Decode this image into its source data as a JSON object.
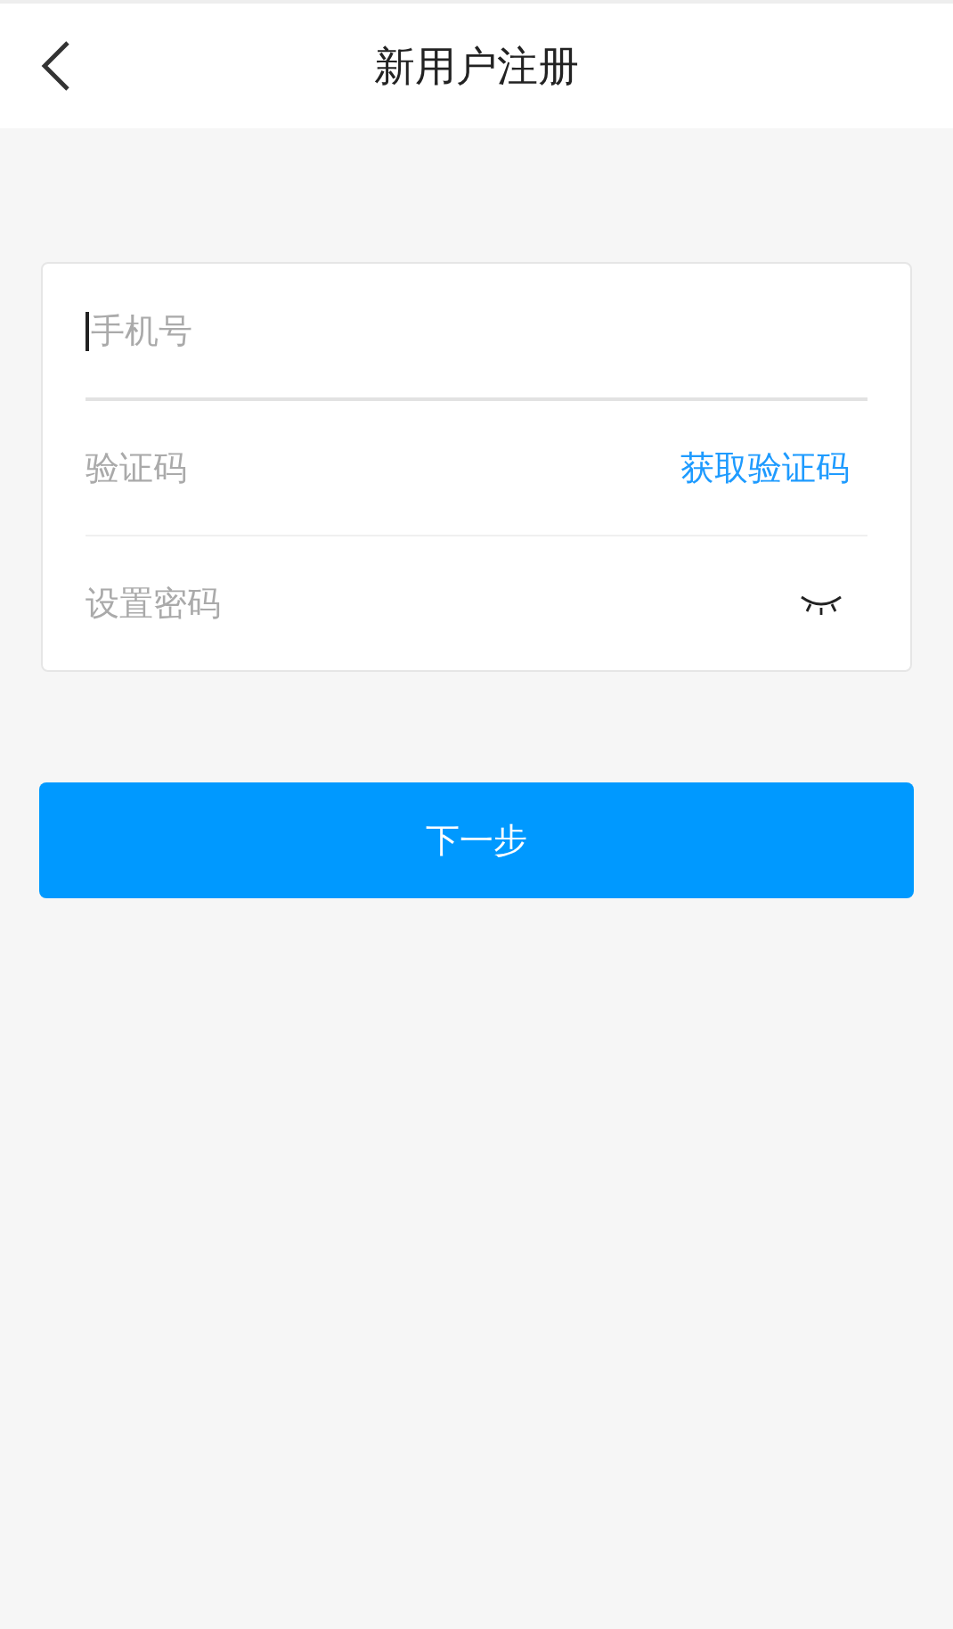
{
  "header": {
    "title": "新用户注册"
  },
  "fields": [
    {
      "kind": "phone",
      "placeholder": "手机号",
      "focused": true
    },
    {
      "kind": "code",
      "placeholder": "验证码",
      "focused": false,
      "action": "获取验证码"
    },
    {
      "kind": "password",
      "placeholder": "设置密码",
      "focused": false,
      "visible": false
    }
  ],
  "submit": {
    "label": "下一步"
  }
}
